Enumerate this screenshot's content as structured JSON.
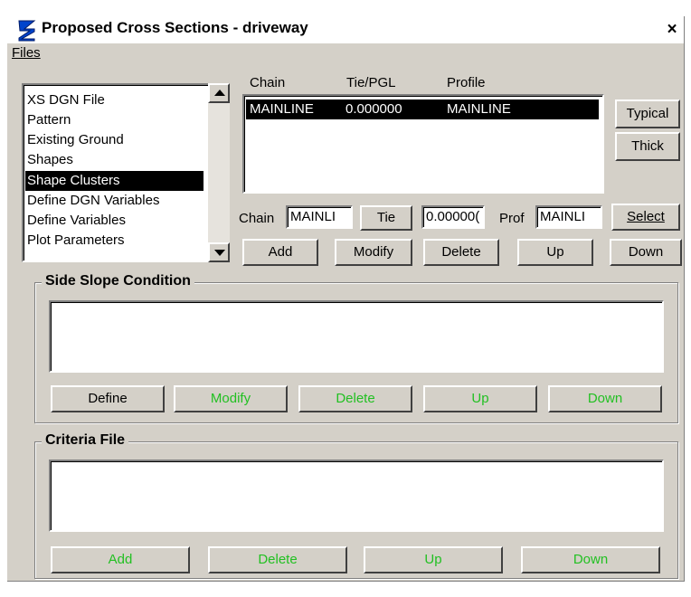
{
  "window": {
    "title": "Proposed Cross Sections - driveway",
    "close": "×"
  },
  "menu": {
    "files": "Files"
  },
  "categories": {
    "items": [
      "XS DGN File",
      "Pattern",
      "Existing Ground",
      "Shapes",
      "Shape Clusters",
      "Define DGN Variables",
      "Define Variables",
      "Plot Parameters"
    ],
    "selected": "Shape Clusters"
  },
  "chain_table": {
    "headers": [
      "Chain",
      "Tie/PGL",
      "Profile"
    ],
    "rows": [
      {
        "chain": "MAINLINE",
        "tie": "0.000000",
        "profile": "MAINLINE"
      }
    ]
  },
  "side_buttons": {
    "typical": "Typical",
    "thick": "Thick"
  },
  "chain_edit": {
    "chain_label": "Chain",
    "chain_value": "MAINLI",
    "tie_button": "Tie",
    "tie_value": "0.00000(",
    "prof_label": "Prof",
    "prof_value": "MAINLI",
    "select_button": "Select"
  },
  "chain_buttons": {
    "add": "Add",
    "modify": "Modify",
    "delete": "Delete",
    "up": "Up",
    "down": "Down"
  },
  "side_slope": {
    "title": "Side Slope Condition",
    "buttons": {
      "define": "Define",
      "modify": "Modify",
      "delete": "Delete",
      "up": "Up",
      "down": "Down"
    }
  },
  "criteria": {
    "title": "Criteria File",
    "buttons": {
      "add": "Add",
      "delete": "Delete",
      "up": "Up",
      "down": "Down"
    }
  },
  "colors": {
    "dialog_bg": "#d4d0c8",
    "selection": "#000000",
    "disabled_green": "#22c022"
  }
}
